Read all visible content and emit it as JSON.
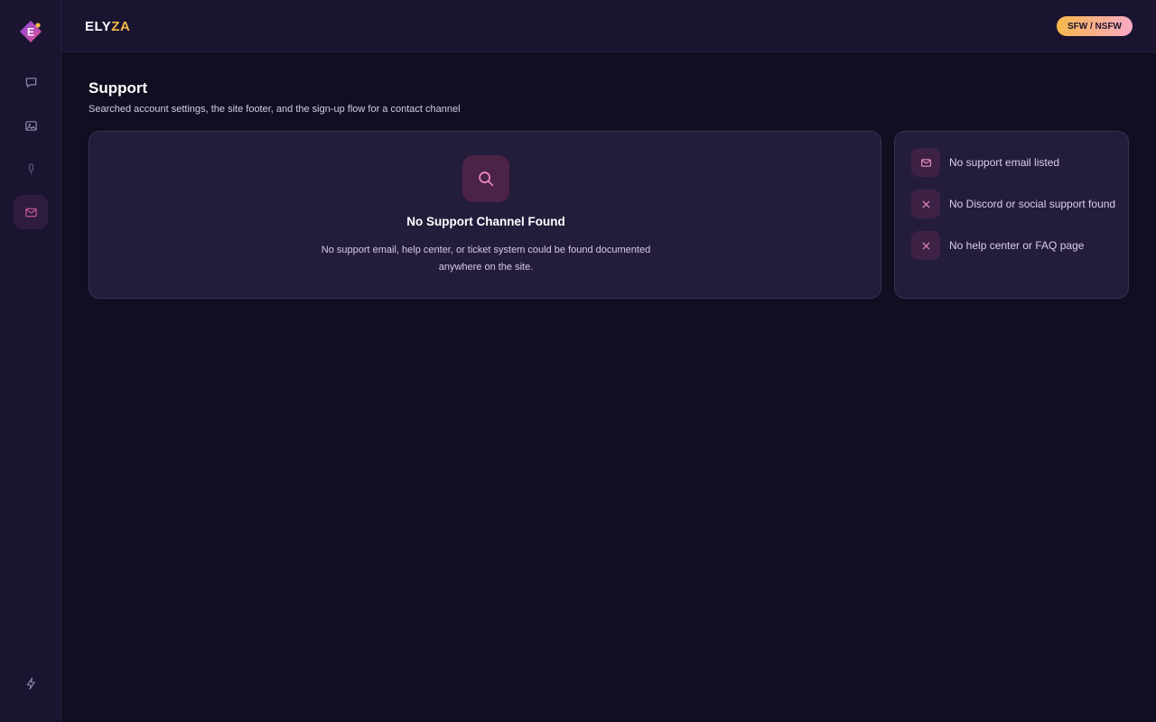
{
  "brand": {
    "part1": "ELY",
    "part2": "ZA",
    "logo_letter": "E"
  },
  "topbar": {
    "mode_badge": "SFW / NSFW"
  },
  "sidebar": {
    "items": [
      {
        "icon": "chat-bubble-icon",
        "active": false
      },
      {
        "icon": "image-icon",
        "active": false
      },
      {
        "icon": "microphone-icon",
        "active": false
      },
      {
        "icon": "mail-icon",
        "active": true
      }
    ],
    "bottom_icon": "lightning-icon"
  },
  "page": {
    "title": "Support",
    "subtitle": "Searched account settings, the site footer, and the sign-up flow for a contact channel"
  },
  "result_card": {
    "icon": "search-icon",
    "heading": "No Support Channel Found",
    "description": "No support email, help center, or ticket system could be found documented anywhere on the site."
  },
  "checks": [
    {
      "icon": "mail-icon",
      "label": "No support email listed"
    },
    {
      "icon": "close-icon",
      "label": "No Discord or social support found"
    },
    {
      "icon": "close-icon",
      "label": "No help center or FAQ page"
    }
  ],
  "colors": {
    "background": "#120e21",
    "panel": "#1a1430",
    "card": "#241c3b",
    "accent_pink": "#e77bbd",
    "accent_gold": "#f5b94a"
  }
}
